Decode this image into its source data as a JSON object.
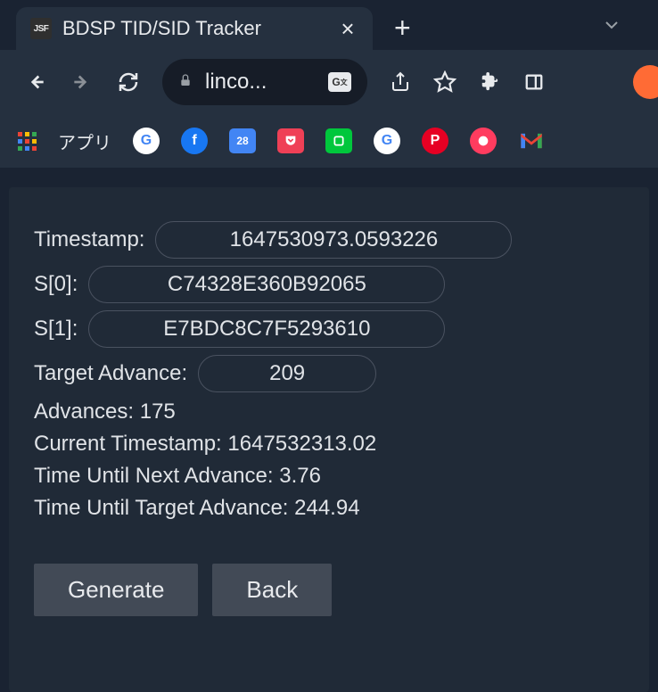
{
  "browser": {
    "tab": {
      "favicon_text": "JSF",
      "title": "BDSP TID/SID Tracker"
    },
    "address": {
      "url_display": "linco..."
    },
    "bookmarks": {
      "apps_label": "アプリ",
      "calendar_day": "28"
    }
  },
  "tracker": {
    "labels": {
      "timestamp": "Timestamp:",
      "s0": "S[0]:",
      "s1": "S[1]:",
      "target_advance": "Target Advance:",
      "advances": "Advances:",
      "current_timestamp": "Current Timestamp:",
      "time_until_next": "Time Until Next Advance:",
      "time_until_target": "Time Until Target Advance:"
    },
    "values": {
      "timestamp": "1647530973.0593226",
      "s0": "C74328E360B92065",
      "s1": "E7BDC8C7F5293610",
      "target_advance": "209",
      "advances": "175",
      "current_timestamp": "1647532313.02",
      "time_until_next": "3.76",
      "time_until_target": "244.94"
    },
    "buttons": {
      "generate": "Generate",
      "back": "Back"
    }
  }
}
